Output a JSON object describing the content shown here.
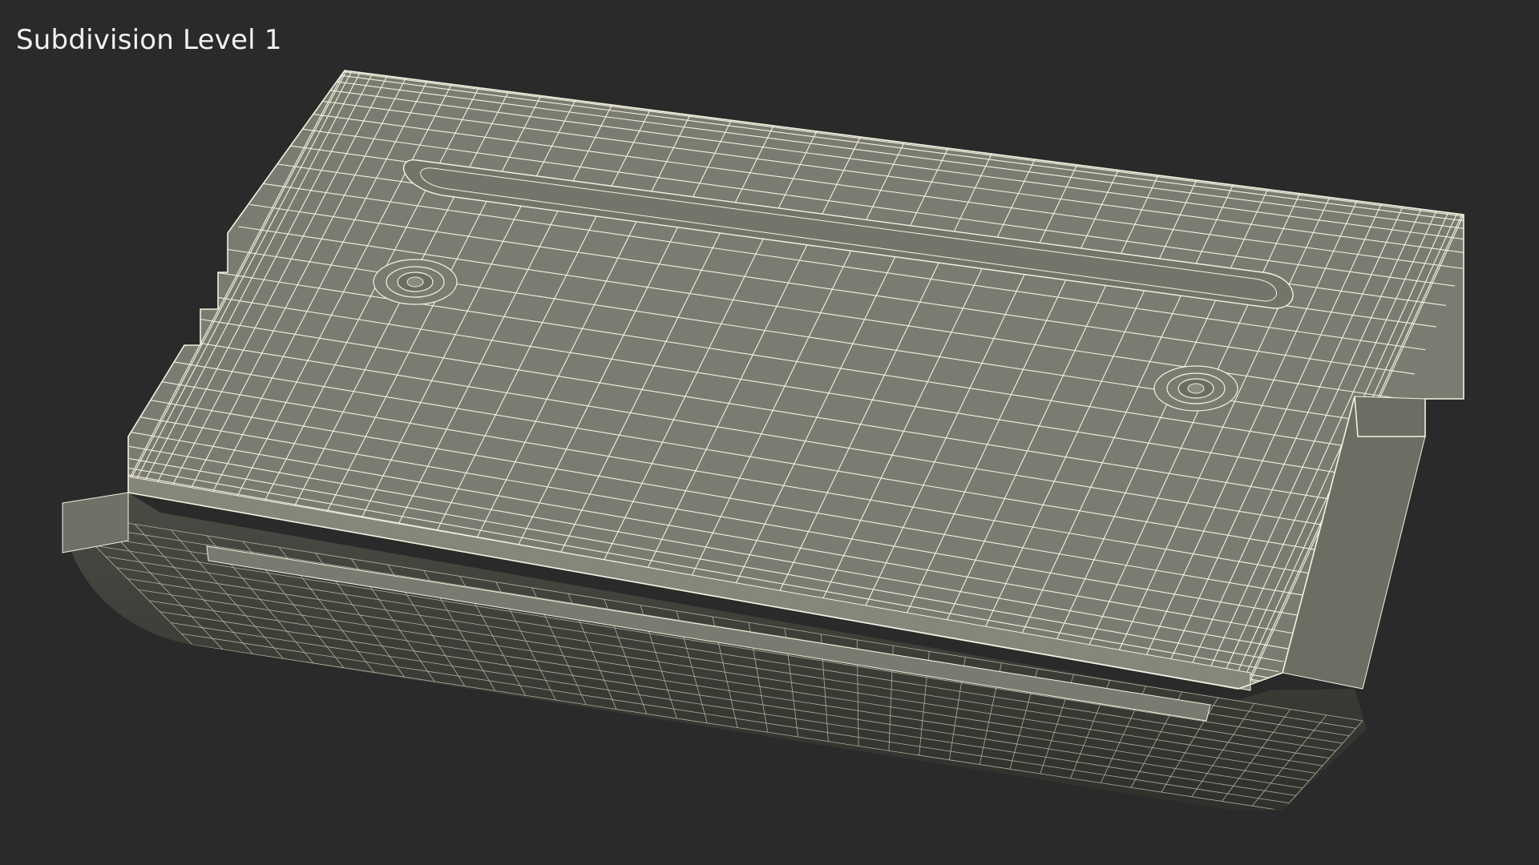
{
  "overlay": {
    "label": "Subdivision Level 1"
  },
  "render": {
    "background_color": "#2a2a2a",
    "surface_color": "#7b7c71",
    "shadow_color": "#3f403a",
    "wire_color": "#f3f1e0",
    "subject_icon": "wireframe-mesh-icon"
  }
}
